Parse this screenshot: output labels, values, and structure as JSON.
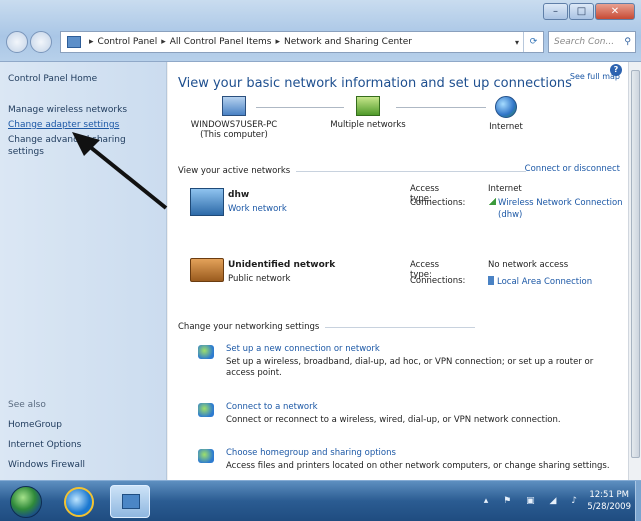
{
  "window": {
    "buttons": {
      "minimize": "–",
      "maximize": "□",
      "close": "✕"
    },
    "breadcrumb": [
      "Control Panel",
      "All Control Panel Items",
      "Network and Sharing Center"
    ],
    "search_placeholder": "Search Con..."
  },
  "sidebar": {
    "home": "Control Panel Home",
    "links": [
      "Manage wireless networks",
      "Change adapter settings",
      "Change advanced sharing",
      "settings"
    ],
    "see_also_label": "See also",
    "see_also": [
      "HomeGroup",
      "Internet Options",
      "Windows Firewall"
    ]
  },
  "main": {
    "title": "View your basic network information and set up connections",
    "see_full_map": "See full map",
    "map_nodes": [
      {
        "label": "WINDOWS7USER-PC",
        "sub": "(This computer)"
      },
      {
        "label": "Multiple networks",
        "sub": ""
      },
      {
        "label": "Internet",
        "sub": ""
      }
    ],
    "active_header": "View your active networks",
    "connect_disconnect": "Connect or disconnect",
    "networks": [
      {
        "name": "dhw",
        "type": "Work network",
        "access_label": "Access type:",
        "access_value": "Internet",
        "conn_label": "Connections:",
        "conn_value": "Wireless Network Connection",
        "conn_value2": "(dhw)"
      },
      {
        "name": "Unidentified network",
        "type": "Public network",
        "access_label": "Access type:",
        "access_value": "No network access",
        "conn_label": "Connections:",
        "conn_value": "Local Area Connection"
      }
    ],
    "settings_header": "Change your networking settings",
    "tasks": [
      {
        "title": "Set up a new connection or network",
        "desc": "Set up a wireless, broadband, dial-up, ad hoc, or VPN connection; or set up a router or access point."
      },
      {
        "title": "Connect to a network",
        "desc": "Connect or reconnect to a wireless, wired, dial-up, or VPN network connection."
      },
      {
        "title": "Choose homegroup and sharing options",
        "desc": "Access files and printers located on other network computers, or change sharing settings."
      }
    ]
  },
  "taskbar": {
    "tray_icons": "▴ ⚑ ▣ ◢ ♪",
    "time": "12:51 PM",
    "date": "5/28/2009"
  }
}
